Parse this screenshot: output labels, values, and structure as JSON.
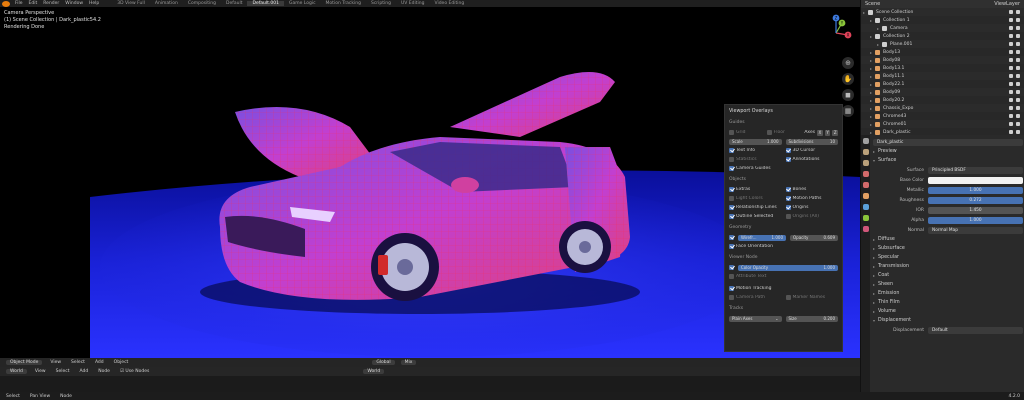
{
  "topbar": {
    "menus": [
      "File",
      "Edit",
      "Render",
      "Window",
      "Help"
    ],
    "workspaces": [
      "3D View Full",
      "Animation",
      "Compositing",
      "Default",
      "Default.001",
      "Game Logic",
      "Motion Tracking",
      "Scripting",
      "UV Editing",
      "Video Editing"
    ],
    "active_workspace": "Default.001"
  },
  "viewport": {
    "info_line1": "Camera Perspective",
    "info_line2": "(1) Scene Collection | Dark_plastic54.2",
    "info_line3": "Rendering Done",
    "gizmo_axes": [
      "X",
      "Y",
      "Z"
    ]
  },
  "overlays": {
    "title": "Viewport Overlays",
    "guides_head": "Guides",
    "grid": "Grid",
    "floor": "Floor",
    "axes": "Axes",
    "axes_btns": [
      "X",
      "Y",
      "Z"
    ],
    "scale_label": "Scale",
    "scale_value": "1.000",
    "subdivisions_label": "Subdivisions",
    "subdivisions_value": "10",
    "text_info": "Text Info",
    "cursor_3d": "3D Cursor",
    "statistics": "Statistics",
    "annotations": "Annotations",
    "camera_guides": "Camera Guides",
    "objects_head": "Objects",
    "extras": "Extras",
    "bones": "Bones",
    "light_colors": "Light Colors",
    "motion_paths": "Motion Paths",
    "relationship_lines": "Relationship Lines",
    "origins": "Origins",
    "outline_selected": "Outline Selected",
    "origins_all": "Origins (All)",
    "geometry_head": "Geometry",
    "wireframe_label": "Wirefr...",
    "wireframe_value": "1.000",
    "opacity_label": "Opacity",
    "opacity_value": "0.609",
    "face_orientation": "Face Orientation",
    "viewer_head": "Viewer Node",
    "color_opacity_label": "Color Opacity",
    "color_opacity_value": "1.000",
    "attribute_text": "Attribute Text",
    "motion_tracking": "Motion Tracking",
    "camera_path": "Camera Path",
    "marker_names": "Marker Names",
    "tracks_head": "Tracks",
    "tracks_value": "Plain Axes",
    "size_label": "Size",
    "size_value": "0.200"
  },
  "viewport_footer": {
    "mode": "Object Mode",
    "menus": [
      "View",
      "Select",
      "Add",
      "Object"
    ],
    "transform": "Global",
    "mix": "Mix"
  },
  "node_header": {
    "world": "World",
    "menus": [
      "View",
      "Select",
      "Add",
      "Node"
    ],
    "use_nodes": "Use Nodes",
    "world_name": "World"
  },
  "statusbar": {
    "items": [
      "Select",
      "Pan View",
      "Node"
    ],
    "version": "4.2.0"
  },
  "outliner": {
    "header_scene": "Scene",
    "header_view_layer": "ViewLayer",
    "rows": [
      {
        "label": "Scene Collection",
        "color": "#cfcfcf",
        "indent": 0
      },
      {
        "label": "Collection 1",
        "color": "#cfcfcf",
        "indent": 1
      },
      {
        "label": "Camera",
        "color": "#cfcfcf",
        "indent": 2
      },
      {
        "label": "Collection 2",
        "color": "#cfcfcf",
        "indent": 1
      },
      {
        "label": "Plane.001",
        "color": "#cfcfcf",
        "indent": 2
      },
      {
        "label": "Body13",
        "color": "#e2a062",
        "indent": 1
      },
      {
        "label": "Body08",
        "color": "#e2a062",
        "indent": 1
      },
      {
        "label": "Body13.1",
        "color": "#e2a062",
        "indent": 1
      },
      {
        "label": "Body11.1",
        "color": "#e2a062",
        "indent": 1
      },
      {
        "label": "Body22.1",
        "color": "#e2a062",
        "indent": 1
      },
      {
        "label": "Body09",
        "color": "#e2a062",
        "indent": 1
      },
      {
        "label": "Body20.2",
        "color": "#e2a062",
        "indent": 1
      },
      {
        "label": "Chassis_Expo",
        "color": "#e2a062",
        "indent": 1
      },
      {
        "label": "Chrome43",
        "color": "#e2a062",
        "indent": 1
      },
      {
        "label": "Chrome01",
        "color": "#e2a062",
        "indent": 1
      },
      {
        "label": "Dark_plastic",
        "color": "#e2a062",
        "indent": 1
      }
    ]
  },
  "properties": {
    "material_name": "Dark_plastic",
    "preview": "Preview",
    "surface_head": "Surface",
    "surface_label": "Surface",
    "surface_value": "Principled BSDF",
    "base_color_label": "Base Color",
    "metallic_label": "Metallic",
    "metallic_value": "1.000",
    "roughness_label": "Roughness",
    "roughness_value": "0.272",
    "ior_label": "IOR",
    "ior_value": "1.450",
    "alpha_label": "Alpha",
    "alpha_value": "1.000",
    "normal_label": "Normal",
    "normal_value": "Normal Map",
    "subsections": [
      "Diffuse",
      "Subsurface",
      "Specular",
      "Transmission",
      "Coat",
      "Sheen",
      "Emission",
      "Thin Film"
    ],
    "volume_head": "Volume",
    "displacement_head": "Displacement",
    "displacement_label": "Displacement",
    "displacement_value": "Default"
  },
  "colors": {
    "floor_blue": "#1a22d8",
    "car_magenta": "#c23fd0",
    "wire_red": "#ff2a4a",
    "accent_blue": "#4772b3",
    "blender_orange": "#e87d0d"
  }
}
